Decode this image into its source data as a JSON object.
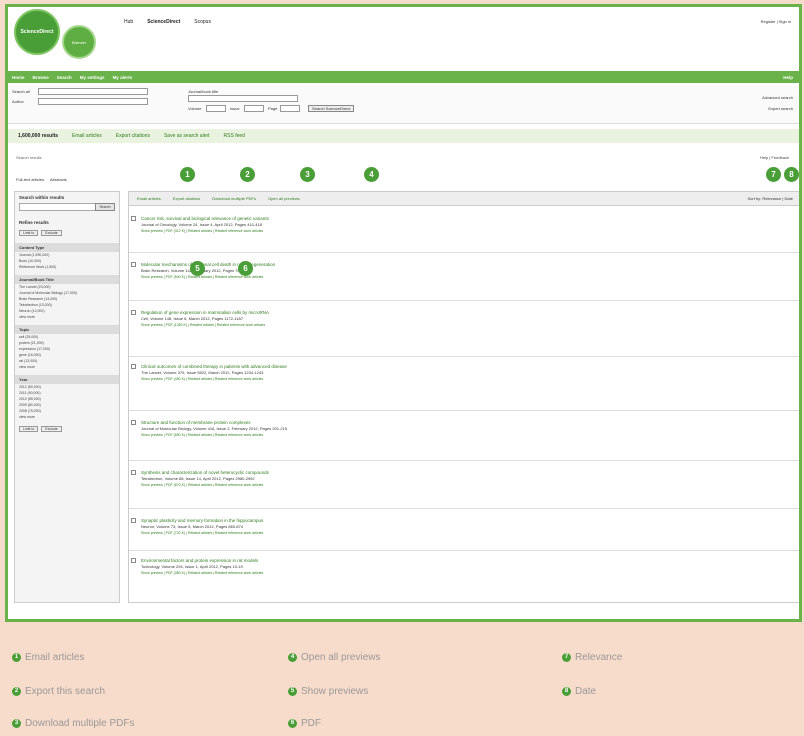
{
  "header": {
    "logo_big": "ScienceDirect",
    "logo_small": "Elsevier",
    "nav": [
      "Hub",
      "ScienceDirect",
      "Scopus"
    ],
    "top_right": "Register | Sign in"
  },
  "navbar": {
    "items": [
      "Home",
      "Browse",
      "Search",
      "My settings",
      "My alerts"
    ],
    "right": "Help"
  },
  "search": {
    "fields": [
      {
        "label": "Search all",
        "value": "",
        "placeholder": ""
      },
      {
        "label": "Author",
        "value": ""
      },
      {
        "label": "Journal/book title",
        "value": ""
      },
      {
        "label": "Volume",
        "value": ""
      },
      {
        "label": "Issue",
        "value": ""
      },
      {
        "label": "Page",
        "value": ""
      }
    ],
    "search_button": "Search ScienceDirect",
    "advanced": "Advanced search",
    "expert": "Expert search"
  },
  "result_bar": {
    "count": "1,600,000 results",
    "actions": [
      "Email articles",
      "Export citations",
      "Save as search alert",
      "RSS feed"
    ]
  },
  "breadcrumb": "Search results",
  "crumb_right": "Help | Feedback",
  "view_tabs": [
    "Full-text articles",
    "Abstracts"
  ],
  "sidebar": {
    "title": "Search within results",
    "go": "Search",
    "refine_title": "Refine results",
    "refine_btns": [
      "Limit to",
      "Exclude"
    ],
    "sections": [
      {
        "head": "Content Type",
        "items": [
          "Journal (1,590,000)",
          "Book (10,000)",
          "Reference Work (1,500)"
        ]
      },
      {
        "head": "Journal/Book Title",
        "items": [
          "The Lancet (23,000)",
          "Journal of Molecular Biology (17,000)",
          "Brain Research (14,000)",
          "Tetrahedron (13,000)",
          "Neuron (12,000)",
          "view more"
        ]
      },
      {
        "head": "Topic",
        "items": [
          "cell (25,000)",
          "protein (21,000)",
          "expression (17,000)",
          "gene (16,000)",
          "rat (13,000)",
          "view more"
        ]
      },
      {
        "head": "Year",
        "items": [
          "2012 (80,000)",
          "2011 (90,000)",
          "2010 (85,000)",
          "2009 (80,000)",
          "2008 (75,000)",
          "view more"
        ]
      }
    ],
    "bottom_btns": [
      "Limit to",
      "Exclude"
    ]
  },
  "toolbar": {
    "items": [
      "Email articles",
      "Export citations",
      "Download multiple PDFs",
      "Open all previews"
    ],
    "sort": "Sort by: Relevance | Date"
  },
  "results": [
    {
      "title": "Cancer risk, survival and biological relevance of genetic variants",
      "meta": "Journal of Oncology, Volume 24, Issue 4, April 2012, Pages 410-418",
      "links": "Show preview | PDF (312 K) | Related articles | Related reference work articles"
    },
    {
      "title": "Molecular mechanisms of neuronal cell death in neurodegeneration",
      "meta": "Brain Research, Volume 1427, January 2012, Pages 70-84",
      "links": "Show preview | PDF (540 K) | Related articles | Related reference work articles"
    },
    {
      "title": "Regulation of gene expression in mammalian cells by microRNA",
      "meta": "Cell, Volume 148, Issue 6, March 2012, Pages 1172-1187",
      "links": "Show preview | PDF (1280 K) | Related articles | Related reference work articles"
    },
    {
      "title": "Clinical outcomes of combined therapy in patients with advanced disease",
      "meta": "The Lancet, Volume 379, Issue 9822, March 2012, Pages 1234-1243",
      "links": "Show preview | PDF (450 K) | Related articles | Related reference work articles"
    },
    {
      "title": "Structure and function of membrane protein complexes",
      "meta": "Journal of Molecular Biology, Volume 416, Issue 2, February 2012, Pages 201-215",
      "links": "Show preview | PDF (890 K) | Related articles | Related reference work articles"
    },
    {
      "title": "Synthesis and characterization of novel heterocyclic compounds",
      "meta": "Tetrahedron, Volume 68, Issue 14, April 2012, Pages 2980-2992",
      "links": "Show preview | PDF (670 K) | Related articles | Related reference work articles"
    },
    {
      "title": "Synaptic plasticity and memory formation in the hippocampus",
      "meta": "Neuron, Volume 73, Issue 5, March 2012, Pages 860-874",
      "links": "Show preview | PDF (720 K) | Related articles | Related reference work articles"
    },
    {
      "title": "Environmental factors and protein expression in rat models",
      "meta": "Toxicology, Volume 294, Issue 1, April 2012, Pages 10-19",
      "links": "Show preview | PDF (380 K) | Related articles | Related reference work articles"
    }
  ],
  "markers": [
    "1",
    "2",
    "3",
    "4",
    "5",
    "6",
    "7",
    "8"
  ],
  "legend": [
    {
      "num": "1",
      "label": "Email articles"
    },
    {
      "num": "2",
      "label": "Export this search"
    },
    {
      "num": "3",
      "label": "Download multiple PDFs"
    },
    {
      "num": "4",
      "label": "Open all previews"
    },
    {
      "num": "5",
      "label": "Show previews"
    },
    {
      "num": "6",
      "label": "PDF"
    },
    {
      "num": "7",
      "label": "Relevance"
    },
    {
      "num": "8",
      "label": "Date"
    }
  ],
  "colors": {
    "brand": "#4a9e37",
    "accent": "#6ab24a",
    "page_bg": "#f8dccb"
  }
}
